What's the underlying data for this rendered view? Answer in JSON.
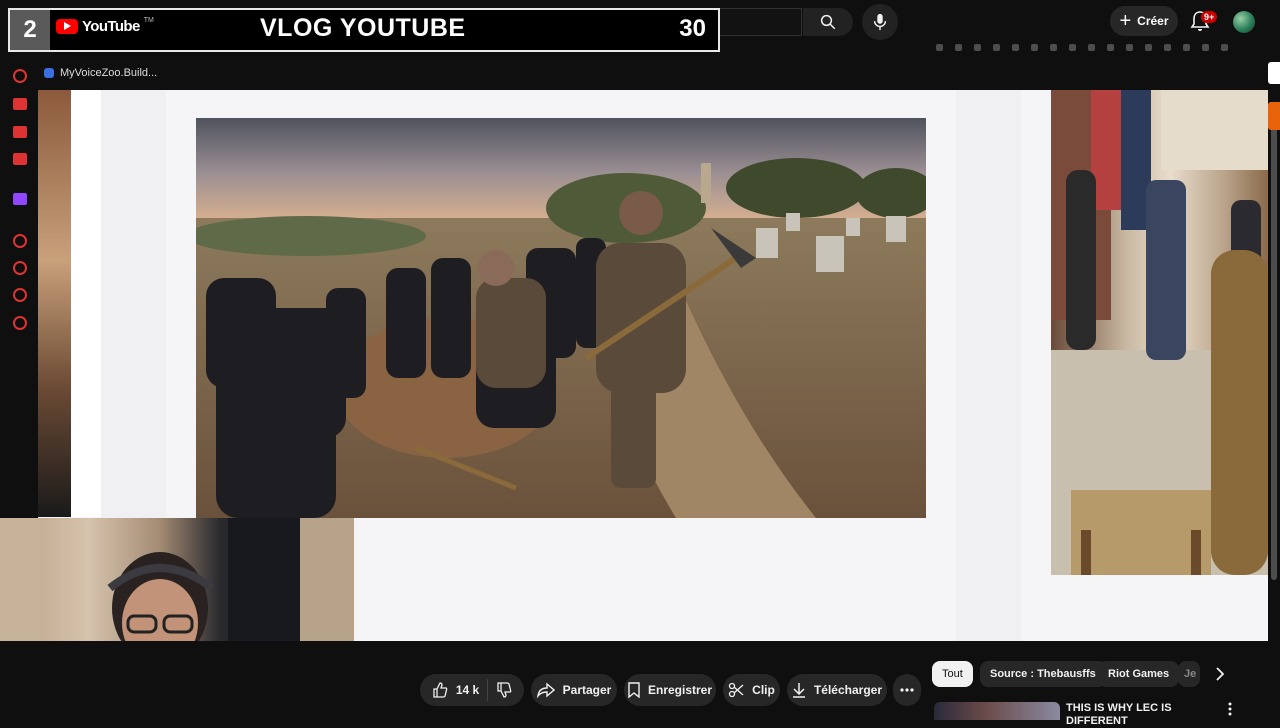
{
  "overlay": {
    "number": "2",
    "logo_text": "YouTube",
    "logo_tm": "TM",
    "title": "VLOG YOUTUBE",
    "count": "30"
  },
  "header": {
    "create_label": "Créer",
    "notifications_badge": "9+"
  },
  "bookmarks": {
    "item_label": "MyVoiceZoo.Build..."
  },
  "actions": {
    "likes": "14 k",
    "share_label": "Partager",
    "save_label": "Enregistrer",
    "clip_label": "Clip",
    "download_label": "Télécharger"
  },
  "chips": {
    "all": "Tout",
    "source": "Source : Thebausffs",
    "riot": "Riot Games",
    "partial": "Je"
  },
  "recommendation": {
    "title": "THIS IS WHY LEC IS DIFFERENT"
  },
  "colors": {
    "background": "#0f0f0f",
    "accent_red": "#ff0000",
    "pill_bg": "#272727"
  }
}
